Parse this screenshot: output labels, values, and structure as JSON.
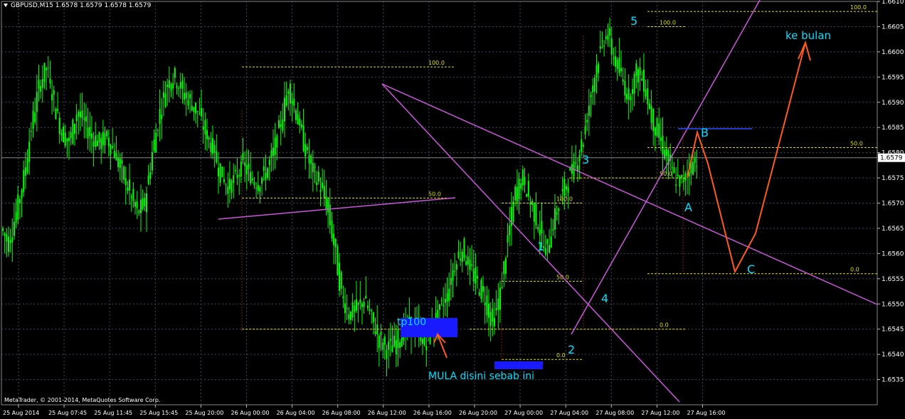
{
  "header": {
    "symbol_line": "GBPUSD,M15  1.6578 1.6579 1.6578 1.6579"
  },
  "footer": {
    "copyright": "MetaTrader, © 2001-2014, MetaQuotes Software Corp."
  },
  "colors": {
    "background": "#000000",
    "grid": "#3a4a5a",
    "candles": "#00ff00",
    "trendline": "#cc55dd",
    "fib": "#e0e000",
    "wave_label": "#00e0ff",
    "orange": "#ff5a1e",
    "blue_box": "#1a1aff",
    "blue_line": "#2a4cff",
    "text": "#ffffff"
  },
  "chart_data": {
    "type": "candlestick",
    "symbol": "GBPUSD",
    "timeframe": "M15",
    "ylim": [
      1.653,
      1.661
    ],
    "current_price": "1.6579",
    "yticks": [
      "1.6610",
      "1.6605",
      "1.6600",
      "1.6595",
      "1.6590",
      "1.6585",
      "1.6580",
      "1.6575",
      "1.6570",
      "1.6565",
      "1.6560",
      "1.6555",
      "1.6550",
      "1.6545",
      "1.6540",
      "1.6535"
    ],
    "xticks": [
      "25 Aug 2014",
      "25 Aug 07:45",
      "25 Aug 11:45",
      "25 Aug 15:45",
      "25 Aug 20:00",
      "26 Aug 00:00",
      "26 Aug 04:00",
      "26 Aug 08:00",
      "26 Aug 12:00",
      "26 Aug 16:00",
      "26 Aug 20:00",
      "27 Aug 00:00",
      "27 Aug 04:00",
      "27 Aug 08:00",
      "27 Aug 12:00",
      "27 Aug 16:00"
    ],
    "price_path": [
      1.6565,
      1.6562,
      1.6568,
      1.6575,
      1.6585,
      1.6593,
      1.6597,
      1.659,
      1.6584,
      1.6582,
      1.6588,
      1.6586,
      1.6583,
      1.6582,
      1.6583,
      1.658,
      1.6576,
      1.6572,
      1.6568,
      1.657,
      1.658,
      1.6588,
      1.6594,
      1.6595,
      1.6592,
      1.659,
      1.6588,
      1.6584,
      1.6581,
      1.6576,
      1.6573,
      1.6575,
      1.6578,
      1.6575,
      1.6574,
      1.6576,
      1.658,
      1.6586,
      1.6593,
      1.6588,
      1.6582,
      1.6577,
      1.6574,
      1.657,
      1.6562,
      1.6552,
      1.6548,
      1.6549,
      1.6551,
      1.6547,
      1.6543,
      1.6541,
      1.6542,
      1.6544,
      1.6546,
      1.6545,
      1.6542,
      1.6545,
      1.6549,
      1.6552,
      1.6558,
      1.6561,
      1.6557,
      1.6554,
      1.6551,
      1.6546,
      1.6552,
      1.6563,
      1.6572,
      1.6575,
      1.657,
      1.6566,
      1.656,
      1.6566,
      1.6571,
      1.6575,
      1.6578,
      1.6583,
      1.6592,
      1.6599,
      1.6604,
      1.6599,
      1.6595,
      1.6591,
      1.6596,
      1.6594,
      1.6587,
      1.6583,
      1.6579,
      1.6575,
      1.6574,
      1.6577,
      1.6579
    ],
    "trendlines": [
      {
        "p1": [
          "26 Aug 12:15",
          1.65945
        ],
        "p2": [
          "27 Aug 01:45",
          1.6557
        ]
      },
      {
        "p1": [
          "26 Aug 12:15",
          1.65945
        ],
        "p2": [
          "27 Aug 23:30",
          1.655
        ]
      },
      {
        "p1": [
          "25 Aug 20:45",
          1.65675
        ],
        "p2": [
          "26 Aug 18:00",
          1.65715
        ]
      },
      {
        "p1": [
          "27 Aug 04:15",
          1.6544
        ],
        "p2": [
          "27 Aug 14:30",
          1.6612
        ]
      }
    ],
    "fib_levels": [
      {
        "label": "100.0",
        "price": 1.6597
      },
      {
        "label": "50.0",
        "price": 1.6571
      },
      {
        "label": "0.0",
        "price": 1.6545
      },
      {
        "label": "100.0",
        "price": 1.6605
      },
      {
        "label": "50.0",
        "price": 1.6575
      },
      {
        "label": "0.0",
        "price": 1.6545
      },
      {
        "label": "100.0",
        "price": 1.657
      },
      {
        "label": "50.0",
        "price": 1.65545
      },
      {
        "label": "0.0",
        "price": 1.6539
      },
      {
        "label": "100.0",
        "price": 1.6608
      },
      {
        "label": "50.0",
        "price": 1.6581
      },
      {
        "label": "0.0",
        "price": 1.6556
      }
    ],
    "wave_labels": [
      "1",
      "2",
      "3",
      "4",
      "5",
      "A",
      "B",
      "C"
    ],
    "annotations": {
      "target": "ke bulan",
      "start_note": "MULA disini sebab ini",
      "tp_label": "tp100"
    }
  }
}
